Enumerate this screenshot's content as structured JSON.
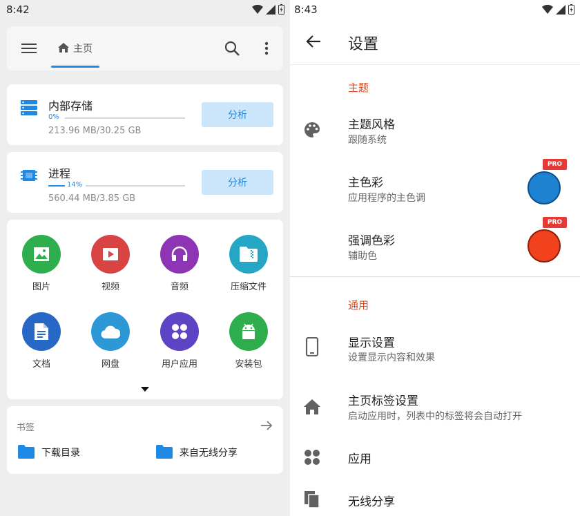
{
  "left": {
    "status": {
      "time": "8:42"
    },
    "toolbar": {
      "tab_label": "主页"
    },
    "storage": {
      "title": "内部存储",
      "percent_text": "0%",
      "percent_value": 0,
      "size": "213.96 MB/30.25 GB",
      "button": "分析"
    },
    "process": {
      "title": "进程",
      "percent_text": "14%",
      "percent_value": 14,
      "size": "560.44 MB/3.85 GB",
      "button": "分析"
    },
    "categories": [
      {
        "label": "图片",
        "icon": "image-icon",
        "color": "#2fae4e"
      },
      {
        "label": "视频",
        "icon": "video-icon",
        "color": "#d84343"
      },
      {
        "label": "音频",
        "icon": "headphones-icon",
        "color": "#8e35b5"
      },
      {
        "label": "压缩文件",
        "icon": "archive-icon",
        "color": "#25a6c4"
      },
      {
        "label": "文档",
        "icon": "document-icon",
        "color": "#2767c5"
      },
      {
        "label": "网盘",
        "icon": "cloud-icon",
        "color": "#2e98d6"
      },
      {
        "label": "用户应用",
        "icon": "apps-icon",
        "color": "#5c44c4"
      },
      {
        "label": "安装包",
        "icon": "android-icon",
        "color": "#2fae4e"
      }
    ],
    "bookmarks": {
      "title": "书签",
      "items": [
        {
          "label": "下载目录"
        },
        {
          "label": "来自无线分享"
        }
      ]
    }
  },
  "right": {
    "status": {
      "time": "8:43"
    },
    "title": "设置",
    "sections": {
      "theme": "主题",
      "general": "通用"
    },
    "prefs": {
      "theme_style": {
        "title": "主题风格",
        "subtitle": "跟随系统"
      },
      "primary_color": {
        "title": "主色彩",
        "subtitle": "应用程序的主色调",
        "color": "#1e82d2",
        "badge": "PRO"
      },
      "accent_color": {
        "title": "强调色彩",
        "subtitle": "辅助色",
        "color": "#f1411d",
        "badge": "PRO"
      },
      "display": {
        "title": "显示设置",
        "subtitle": "设置显示内容和效果"
      },
      "home_tabs": {
        "title": "主页标签设置",
        "subtitle": "启动应用时，列表中的标签将会自动打开"
      },
      "apps": {
        "title": "应用"
      },
      "wireless_share": {
        "title": "无线分享"
      }
    }
  },
  "colors": {
    "accent_blue": "#1e88e5",
    "section_red": "#e64a19",
    "folder_blue": "#1e88e5"
  }
}
